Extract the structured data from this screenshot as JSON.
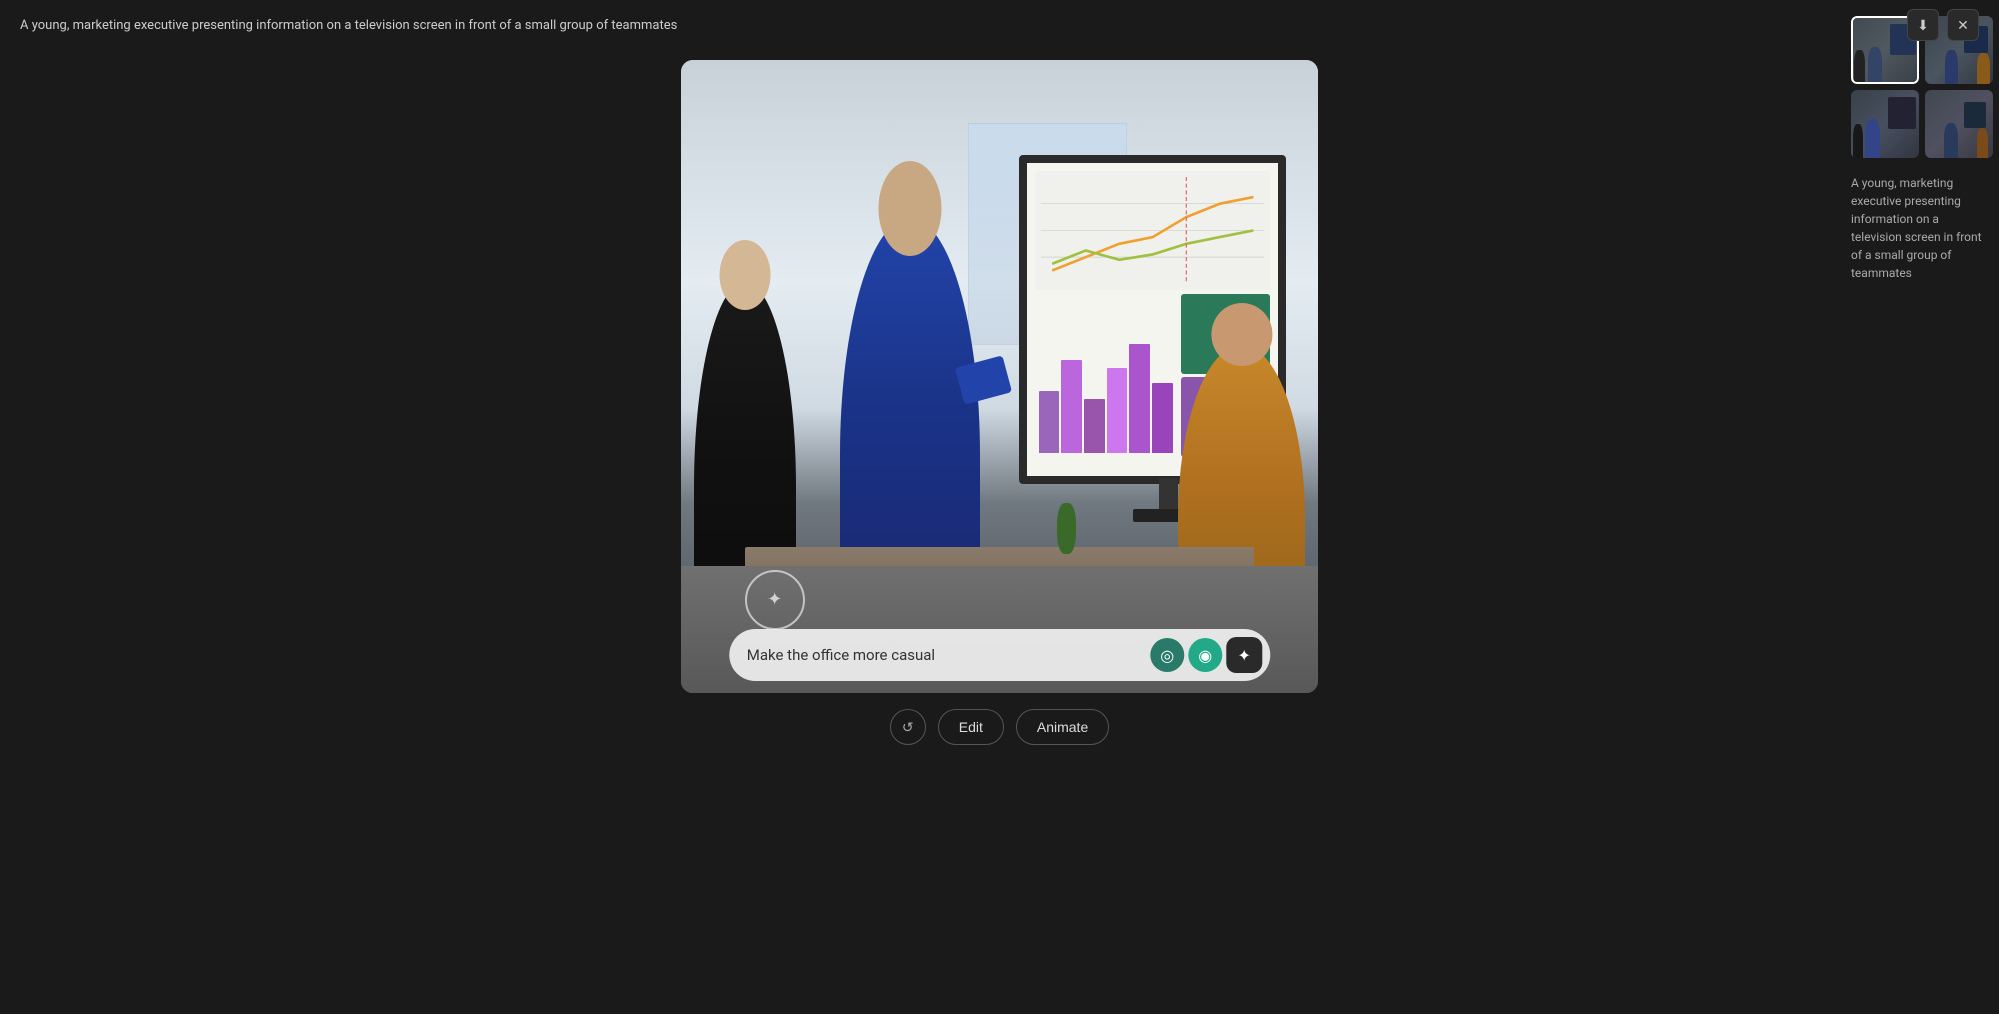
{
  "header": {
    "title": "A young, marketing executive presenting information on a television screen in front of a small group of teammates",
    "download_label": "⬇",
    "close_label": "✕"
  },
  "main_image": {
    "alt": "Office presentation scene with marketing executive"
  },
  "prompt": {
    "text": "Make the office more casual",
    "placeholder": "Make the office more casual"
  },
  "bottom_controls": {
    "refresh_label": "↺",
    "edit_label": "Edit",
    "animate_label": "Animate"
  },
  "sidebar": {
    "description": "A young, marketing executive presenting information on a television screen in front of a small group of teammates",
    "thumbnails": [
      {
        "id": 1,
        "active": true,
        "label": "Thumbnail 1"
      },
      {
        "id": 2,
        "active": false,
        "label": "Thumbnail 2"
      },
      {
        "id": 3,
        "active": false,
        "label": "Thumbnail 3"
      },
      {
        "id": 4,
        "active": false,
        "label": "Thumbnail 4"
      }
    ]
  },
  "icons": {
    "watermark": "✦",
    "prompt_icon_1": "◎",
    "prompt_icon_2": "◉",
    "prompt_icon_3": "✦"
  },
  "colors": {
    "background": "#1a1a1a",
    "header_text": "#cccccc",
    "button_border": "#444444",
    "sidebar_text": "#aaaaaa",
    "prompt_bg": "rgba(240,240,240,0.92)",
    "prompt_text": "#333333",
    "icon_green": "#2a7a6a",
    "icon_emerald": "#22aa88",
    "accent_bar1": "#9966bb",
    "accent_bar2": "#cc66aa",
    "accent_bar3": "#aa44cc"
  }
}
